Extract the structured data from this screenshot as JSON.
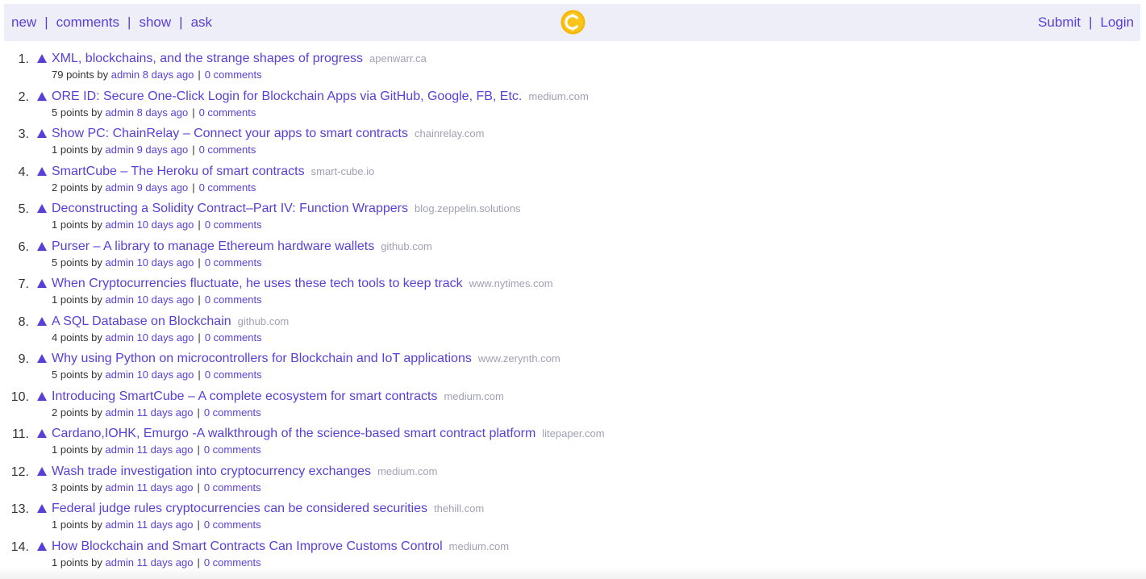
{
  "nav": {
    "left": [
      "new",
      "comments",
      "show",
      "ask"
    ],
    "separator": "|",
    "right": [
      "Submit",
      "Login"
    ],
    "logo_icon": "coin-logo-icon",
    "accent": "#5a3fd6",
    "logo_color": "#f5b800"
  },
  "items": [
    {
      "rank": "1.",
      "title": "XML, blockchains, and the strange shapes of progress",
      "domain": "apenwarr.ca",
      "points": "79 points",
      "by": "by",
      "author": "admin",
      "age": "8 days ago",
      "comments": "0 comments"
    },
    {
      "rank": "2.",
      "title": "ORE ID: Secure One-Click Login for Blockchain Apps via GitHub, Google, FB, Etc.",
      "domain": "medium.com",
      "points": "5 points",
      "by": "by",
      "author": "admin",
      "age": "8 days ago",
      "comments": "0 comments"
    },
    {
      "rank": "3.",
      "title": "Show PC: ChainRelay – Connect your apps to smart contracts",
      "domain": "chainrelay.com",
      "points": "1 points",
      "by": "by",
      "author": "admin",
      "age": "9 days ago",
      "comments": "0 comments"
    },
    {
      "rank": "4.",
      "title": "SmartCube – The Heroku of smart contracts",
      "domain": "smart-cube.io",
      "points": "2 points",
      "by": "by",
      "author": "admin",
      "age": "9 days ago",
      "comments": "0 comments"
    },
    {
      "rank": "5.",
      "title": "Deconstructing a Solidity Contract–Part IV: Function Wrappers",
      "domain": "blog.zeppelin.solutions",
      "points": "1 points",
      "by": "by",
      "author": "admin",
      "age": "10 days ago",
      "comments": "0 comments"
    },
    {
      "rank": "6.",
      "title": "Purser – A library to manage Ethereum hardware wallets",
      "domain": "github.com",
      "points": "5 points",
      "by": "by",
      "author": "admin",
      "age": "10 days ago",
      "comments": "0 comments"
    },
    {
      "rank": "7.",
      "title": "When Cryptocurrencies fluctuate, he uses these tech tools to keep track",
      "domain": "www.nytimes.com",
      "points": "1 points",
      "by": "by",
      "author": "admin",
      "age": "10 days ago",
      "comments": "0 comments"
    },
    {
      "rank": "8.",
      "title": "A SQL Database on Blockchain",
      "domain": "github.com",
      "points": "4 points",
      "by": "by",
      "author": "admin",
      "age": "10 days ago",
      "comments": "0 comments"
    },
    {
      "rank": "9.",
      "title": "Why using Python on microcontrollers for Blockchain and IoT applications",
      "domain": "www.zerynth.com",
      "points": "5 points",
      "by": "by",
      "author": "admin",
      "age": "10 days ago",
      "comments": "0 comments"
    },
    {
      "rank": "10.",
      "title": "Introducing SmartCube – A complete ecosystem for smart contracts",
      "domain": "medium.com",
      "points": "2 points",
      "by": "by",
      "author": "admin",
      "age": "11 days ago",
      "comments": "0 comments"
    },
    {
      "rank": "11.",
      "title": "Cardano,IOHK, Emurgo -A walkthrough of the science-based smart contract platform",
      "domain": "litepaper.com",
      "points": "1 points",
      "by": "by",
      "author": "admin",
      "age": "11 days ago",
      "comments": "0 comments"
    },
    {
      "rank": "12.",
      "title": "Wash trade investigation into cryptocurrency exchanges",
      "domain": "medium.com",
      "points": "3 points",
      "by": "by",
      "author": "admin",
      "age": "11 days ago",
      "comments": "0 comments"
    },
    {
      "rank": "13.",
      "title": "Federal judge rules cryptocurrencies can be considered securities",
      "domain": "thehill.com",
      "points": "1 points",
      "by": "by",
      "author": "admin",
      "age": "11 days ago",
      "comments": "0 comments"
    },
    {
      "rank": "14.",
      "title": "How Blockchain and Smart Contracts Can Improve Customs Control",
      "domain": "medium.com",
      "points": "1 points",
      "by": "by",
      "author": "admin",
      "age": "11 days ago",
      "comments": "0 comments"
    }
  ]
}
